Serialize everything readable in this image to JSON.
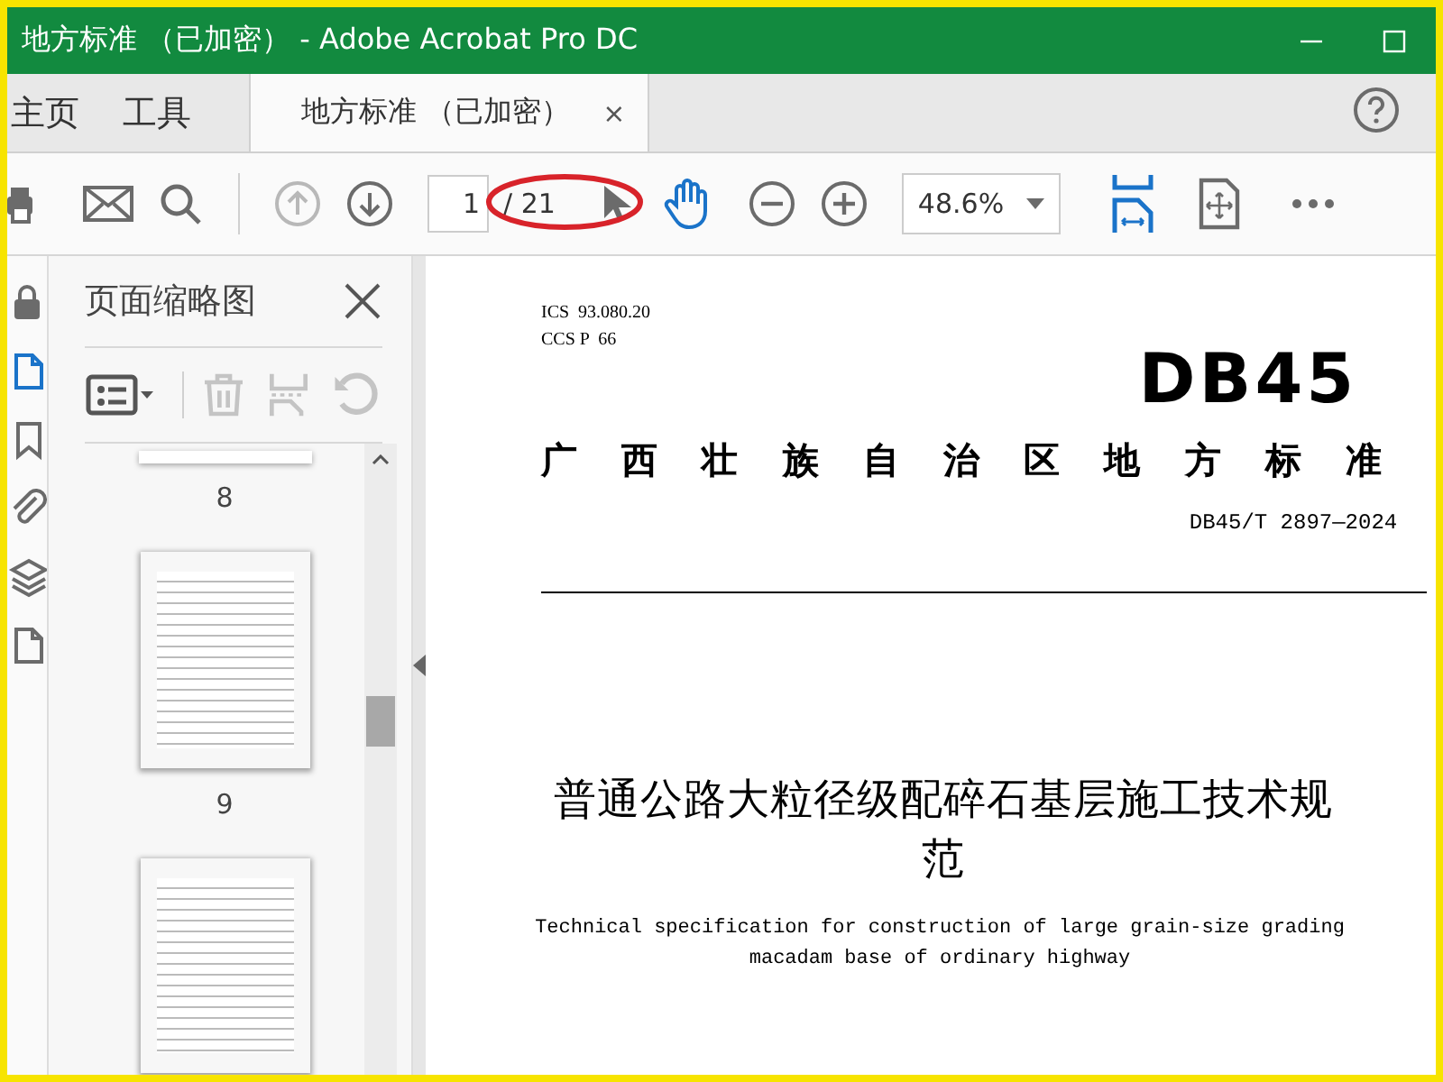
{
  "window": {
    "title": "地方标准 （已加密） - Adobe Acrobat Pro DC"
  },
  "tabs": [
    {
      "label": "主页",
      "kind": "nav",
      "selected": false
    },
    {
      "label": "工具",
      "kind": "nav",
      "selected": false
    },
    {
      "label": "地方标准 （已加密）",
      "kind": "document",
      "selected": true,
      "close": "×"
    }
  ],
  "toolbar": {
    "page_up": {
      "disabled": true
    },
    "page_down": {
      "disabled": false
    },
    "page_number": "1",
    "page_total": "/ 21",
    "hand_tool": {
      "selected": true
    },
    "zoom": "48.6%",
    "fit_width": {
      "selected": true
    }
  },
  "side_rail": [
    {
      "kind": "lock",
      "selected": false
    },
    {
      "kind": "pages",
      "selected": true
    },
    {
      "kind": "bookmark",
      "selected": false
    },
    {
      "kind": "attachment",
      "selected": false
    },
    {
      "kind": "layers",
      "selected": false
    },
    {
      "kind": "document",
      "selected": false
    }
  ],
  "thumbnail_panel": {
    "title": "页面缩略图",
    "tools": [
      {
        "kind": "options",
        "disabled": false
      },
      {
        "kind": "delete",
        "disabled": true
      },
      {
        "kind": "insert",
        "disabled": true
      },
      {
        "kind": "rotate",
        "disabled": true
      }
    ],
    "thumbnails": [
      {
        "label": "8",
        "kind": "partial"
      },
      {
        "label": "9",
        "kind": "full"
      },
      {
        "kind": "full"
      }
    ]
  },
  "document": {
    "ics": "ICS  93.080.20",
    "ccs": "CCS P  66",
    "logo": "DB45",
    "issuer": "广西壮族自治区地方标准",
    "code": "DB45/T 2897—2024",
    "title": "普通公路大粒径级配碎石基层施工技术规范",
    "subtitle": "Technical specification for construction of large grain-size grading macadam base of ordinary highway"
  }
}
